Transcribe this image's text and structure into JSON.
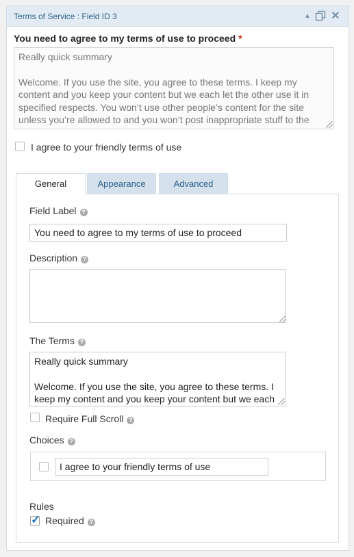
{
  "header": {
    "title": "Terms of Service : Field ID 3",
    "icons": [
      "arrow-up-icon",
      "duplicate-icon",
      "close-icon"
    ]
  },
  "preview": {
    "label": "You need to agree to my terms of use to proceed",
    "required_mark": "*",
    "terms_paragraphs": [
      "Really quick summary",
      "Welcome. If you use the site, you agree to these terms. I keep my content and you keep your content but we each let the other use it in specified respects. You won’t use other people’s content for the site unless you’re allowed to and you won’t post inappropriate stuff to the site. I’m not responsible should things go wrong. I also am not responsible for any content of the site."
    ],
    "choice_label": "I agree to your friendly terms of use",
    "choice_checked": false
  },
  "tabs": [
    {
      "label": "General",
      "active": true
    },
    {
      "label": "Appearance",
      "active": false
    },
    {
      "label": "Advanced",
      "active": false
    }
  ],
  "settings": {
    "field_label": {
      "label": "Field Label",
      "value": "You need to agree to my terms of use to proceed"
    },
    "description": {
      "label": "Description",
      "value": ""
    },
    "terms": {
      "label": "The Terms",
      "paragraphs": [
        "Really quick summary",
        "Welcome. If you use the site, you agree to these terms. I keep my content and you keep your content but we each let the other use it in specified respects."
      ]
    },
    "require_full_scroll": {
      "label": "Require Full Scroll",
      "checked": false
    },
    "choices": {
      "label": "Choices",
      "items": [
        {
          "value": "I agree to your friendly terms of use",
          "checked": false
        }
      ]
    },
    "rules": {
      "label": "Rules",
      "required": {
        "label": "Required",
        "checked": true
      }
    }
  },
  "colors": {
    "accent": "#2b5f8a",
    "header_bg": "#e2ebf3",
    "required": "#c02b0a",
    "checkbox_check": "#1e73be"
  }
}
